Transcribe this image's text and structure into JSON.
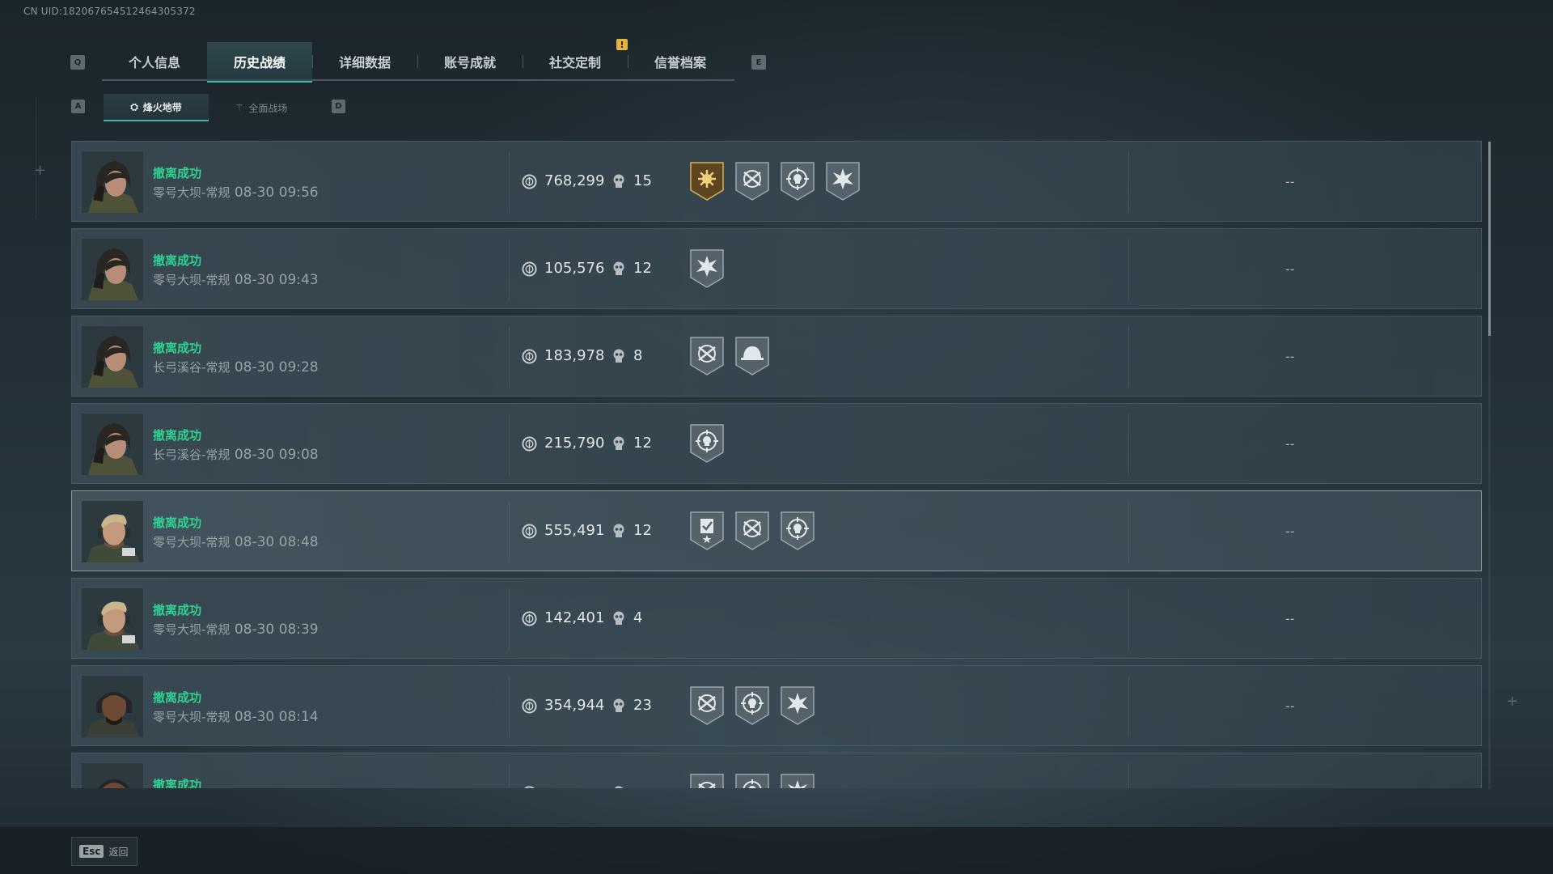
{
  "uid": "CN UID:182067654512464305372",
  "header": {
    "key_left": "Q",
    "key_right": "E",
    "alert": "!",
    "tabs": [
      {
        "label": "个人信息"
      },
      {
        "label": "历史战绩"
      },
      {
        "label": "详细数据"
      },
      {
        "label": "账号成就"
      },
      {
        "label": "社交定制"
      },
      {
        "label": "信誉档案"
      }
    ],
    "active_tab": "历史战绩"
  },
  "subheader": {
    "key_left": "A",
    "key_right": "D",
    "tabs": [
      {
        "label": "烽火地带",
        "icon": "hazard-zone-icon"
      },
      {
        "label": "全面战场",
        "icon": "battlefield-icon"
      }
    ],
    "active_tab": "烽火地带"
  },
  "matches": [
    {
      "avatar": "female-operator-avatar",
      "status": "撤离成功",
      "map": "零号大坝-常规",
      "time": "08-30 09:56",
      "value": "768,299",
      "kills": "15",
      "badges": [
        "gold-sun-badge",
        "crossed-rifles-badge",
        "skull-crosshair-badge",
        "starburst-badge"
      ],
      "extra": "--"
    },
    {
      "avatar": "female-operator-avatar",
      "status": "撤离成功",
      "map": "零号大坝-常规",
      "time": "08-30 09:43",
      "value": "105,576",
      "kills": "12",
      "badges": [
        "starburst-badge"
      ],
      "extra": "--"
    },
    {
      "avatar": "female-operator-avatar",
      "status": "撤离成功",
      "map": "长弓溪谷-常规",
      "time": "08-30 09:28",
      "value": "183,978",
      "kills": "8",
      "badges": [
        "crossed-rifles-badge",
        "helmet-badge"
      ],
      "extra": "--"
    },
    {
      "avatar": "female-operator-avatar",
      "status": "撤离成功",
      "map": "长弓溪谷-常规",
      "time": "08-30 09:08",
      "value": "215,790",
      "kills": "12",
      "badges": [
        "skull-crosshair-badge"
      ],
      "extra": "--"
    },
    {
      "avatar": "male-operator-avatar",
      "status": "撤离成功",
      "map": "零号大坝-常规",
      "time": "08-30 08:48",
      "value": "555,491",
      "kills": "12",
      "badges": [
        "clipboard-star-badge",
        "crossed-rifles-badge",
        "skull-crosshair-badge"
      ],
      "extra": "--"
    },
    {
      "avatar": "male-operator-avatar",
      "status": "撤离成功",
      "map": "零号大坝-常规",
      "time": "08-30 08:39",
      "value": "142,401",
      "kills": "4",
      "badges": [],
      "extra": "--"
    },
    {
      "avatar": "bald-operator-avatar",
      "status": "撤离成功",
      "map": "零号大坝-常规",
      "time": "08-30 08:14",
      "value": "354,944",
      "kills": "23",
      "badges": [
        "crossed-rifles-badge",
        "skull-crosshair-badge",
        "starburst-badge"
      ],
      "extra": "--"
    },
    {
      "avatar": "bald-operator-avatar",
      "status": "撤离成功",
      "map": "",
      "time": "",
      "value": "",
      "kills": "",
      "badges": [
        "crossed-rifles-badge",
        "skull-crosshair-badge",
        "starburst-badge"
      ],
      "extra": ""
    }
  ],
  "footer": {
    "key": "Esc",
    "label": "返回"
  },
  "colors": {
    "accent": "#3fb9a3",
    "success": "#2fd28e",
    "alert": "#e3b43b"
  }
}
